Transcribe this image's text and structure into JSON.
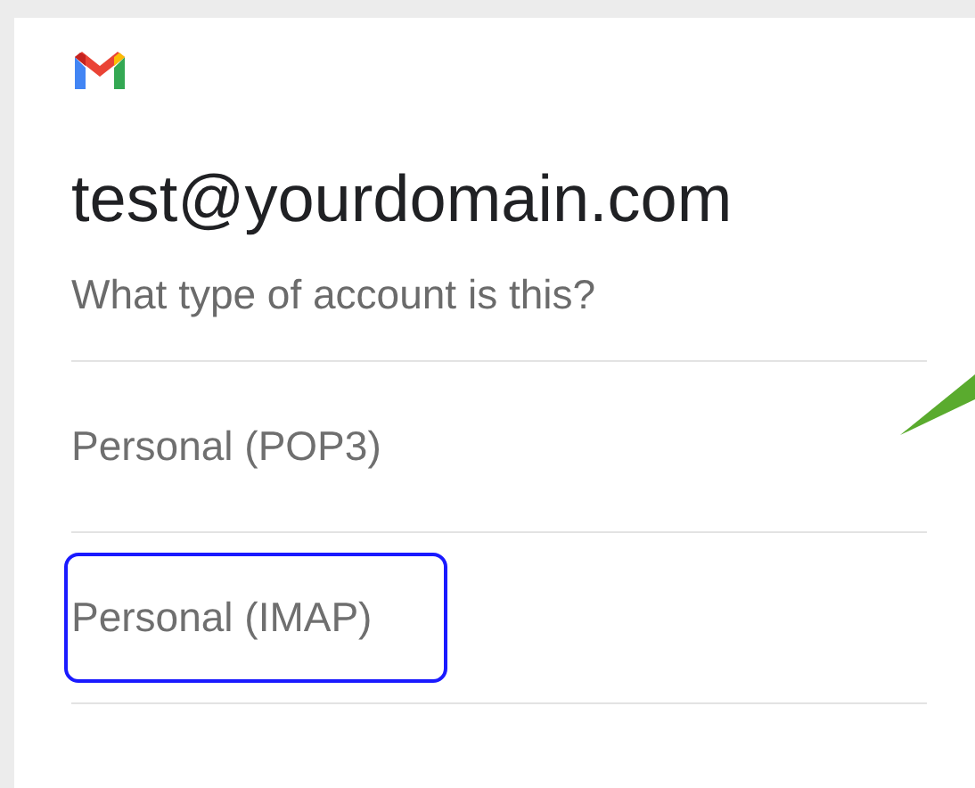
{
  "account": {
    "email": "test@yourdomain.com",
    "question": "What type of account is this?"
  },
  "options": [
    {
      "label": "Personal (POP3)",
      "selected": false
    },
    {
      "label": "Personal (IMAP)",
      "selected": true
    }
  ]
}
